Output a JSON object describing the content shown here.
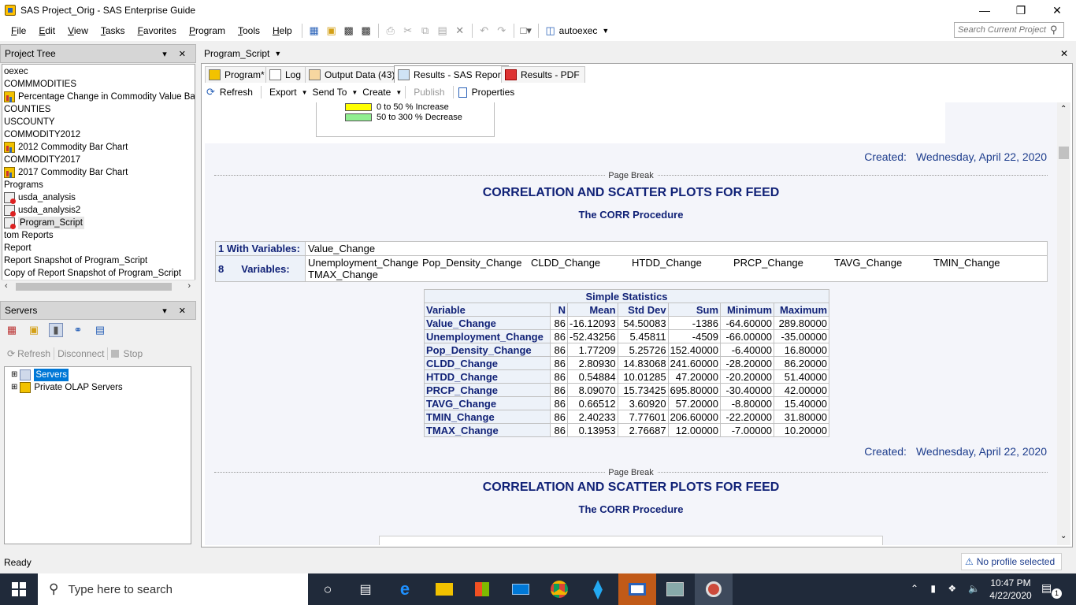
{
  "window": {
    "title": "SAS Project_Orig - SAS Enterprise Guide",
    "minimize": "—",
    "maximize": "❐",
    "close": "✕"
  },
  "menu": {
    "items": [
      {
        "label": "File",
        "accel": "F",
        "rest": "ile"
      },
      {
        "label": "Edit",
        "accel": "E",
        "rest": "dit"
      },
      {
        "label": "View",
        "accel": "V",
        "rest": "iew"
      },
      {
        "label": "Tasks",
        "accel": "T",
        "rest": "asks"
      },
      {
        "label": "Favorites",
        "accel": "F",
        "rest": "avorites"
      },
      {
        "label": "Program",
        "accel": "P",
        "rest": "rogram"
      },
      {
        "label": "Tools",
        "accel": "T",
        "rest": "ools"
      },
      {
        "label": "Help",
        "accel": "H",
        "rest": "elp"
      }
    ],
    "autoexec_label": "autoexec",
    "search_placeholder": "Search Current Project"
  },
  "project_tree": {
    "header": "Project Tree",
    "items": [
      {
        "label": "oexec",
        "icon": ""
      },
      {
        "label": "COMMMODITIES",
        "icon": ""
      },
      {
        "label": "Percentage Change in Commodity Value Bar Ch",
        "icon": "chart"
      },
      {
        "label": "COUNTIES",
        "icon": ""
      },
      {
        "label": "USCOUNTY",
        "icon": ""
      },
      {
        "label": "COMMODITY2012",
        "icon": ""
      },
      {
        "label": "2012 Commodity Bar Chart",
        "icon": "chart"
      },
      {
        "label": "COMMODITY2017",
        "icon": ""
      },
      {
        "label": "2017 Commodity Bar Chart",
        "icon": "chart"
      },
      {
        "label": "Programs",
        "icon": ""
      },
      {
        "label": "usda_analysis",
        "icon": "prog"
      },
      {
        "label": "usda_analysis2",
        "icon": "prog"
      },
      {
        "label": "Program_Script",
        "icon": "prog"
      },
      {
        "label": "tom Reports",
        "icon": ""
      },
      {
        "label": "Report",
        "icon": ""
      },
      {
        "label": "Report Snapshot of Program_Script",
        "icon": ""
      },
      {
        "label": "Copy of Report Snapshot of Program_Script",
        "icon": ""
      }
    ]
  },
  "servers": {
    "header": "Servers",
    "refresh": "Refresh",
    "disconnect": "Disconnect",
    "stop": "Stop",
    "nodes": [
      "Servers",
      "Private OLAP Servers"
    ]
  },
  "document": {
    "title": "Program_Script",
    "tabs": [
      "Program*",
      "Log",
      "Output Data (43)",
      "Results - SAS Report",
      "Results - PDF"
    ],
    "toolbar": {
      "refresh": "Refresh",
      "export": "Export",
      "send_to": "Send To",
      "create": "Create",
      "publish": "Publish",
      "properties": "Properties"
    }
  },
  "report": {
    "legend": [
      {
        "label": "0 to 50 % Increase",
        "color": "#ffff00"
      },
      {
        "label": "50 to 300 % Decrease",
        "color": "#90ee90"
      }
    ],
    "created_label": "Created:",
    "created_date": "Wednesday, April 22, 2020",
    "page_break": "Page Break",
    "title": "CORRELATION AND SCATTER PLOTS FOR FEED",
    "subtitle": "The CORR Procedure",
    "with_vars_label": "1 With Variables:",
    "with_vars_value": "Value_Change",
    "vars_count": "8",
    "vars_label": "Variables:",
    "vars_value": [
      "Unemployment_Change",
      "Pop_Density_Change",
      "CLDD_Change",
      "HTDD_Change",
      "PRCP_Change",
      "TAVG_Change",
      "TMIN_Change",
      "TMAX_Change"
    ],
    "stats": {
      "caption": "Simple Statistics",
      "columns": [
        "Variable",
        "N",
        "Mean",
        "Std Dev",
        "Sum",
        "Minimum",
        "Maximum"
      ],
      "rows": [
        [
          "Value_Change",
          "86",
          "-16.12093",
          "54.50083",
          "-1386",
          "-64.60000",
          "289.80000"
        ],
        [
          "Unemployment_Change",
          "86",
          "-52.43256",
          "5.45811",
          "-4509",
          "-66.00000",
          "-35.00000"
        ],
        [
          "Pop_Density_Change",
          "86",
          "1.77209",
          "5.25726",
          "152.40000",
          "-6.40000",
          "16.80000"
        ],
        [
          "CLDD_Change",
          "86",
          "2.80930",
          "14.83068",
          "241.60000",
          "-28.20000",
          "86.20000"
        ],
        [
          "HTDD_Change",
          "86",
          "0.54884",
          "10.01285",
          "47.20000",
          "-20.20000",
          "51.40000"
        ],
        [
          "PRCP_Change",
          "86",
          "8.09070",
          "15.73425",
          "695.80000",
          "-30.40000",
          "42.00000"
        ],
        [
          "TAVG_Change",
          "86",
          "0.66512",
          "3.60920",
          "57.20000",
          "-8.80000",
          "15.40000"
        ],
        [
          "TMIN_Change",
          "86",
          "2.40233",
          "7.77601",
          "206.60000",
          "-22.20000",
          "31.80000"
        ],
        [
          "TMAX_Change",
          "86",
          "0.13953",
          "2.76687",
          "12.00000",
          "-7.00000",
          "10.20000"
        ]
      ]
    }
  },
  "status": {
    "text": "Ready",
    "profile": "No profile selected"
  },
  "taskbar": {
    "search": "Type here to search",
    "time": "10:47 PM",
    "date": "4/22/2020",
    "notif_count": "1"
  }
}
